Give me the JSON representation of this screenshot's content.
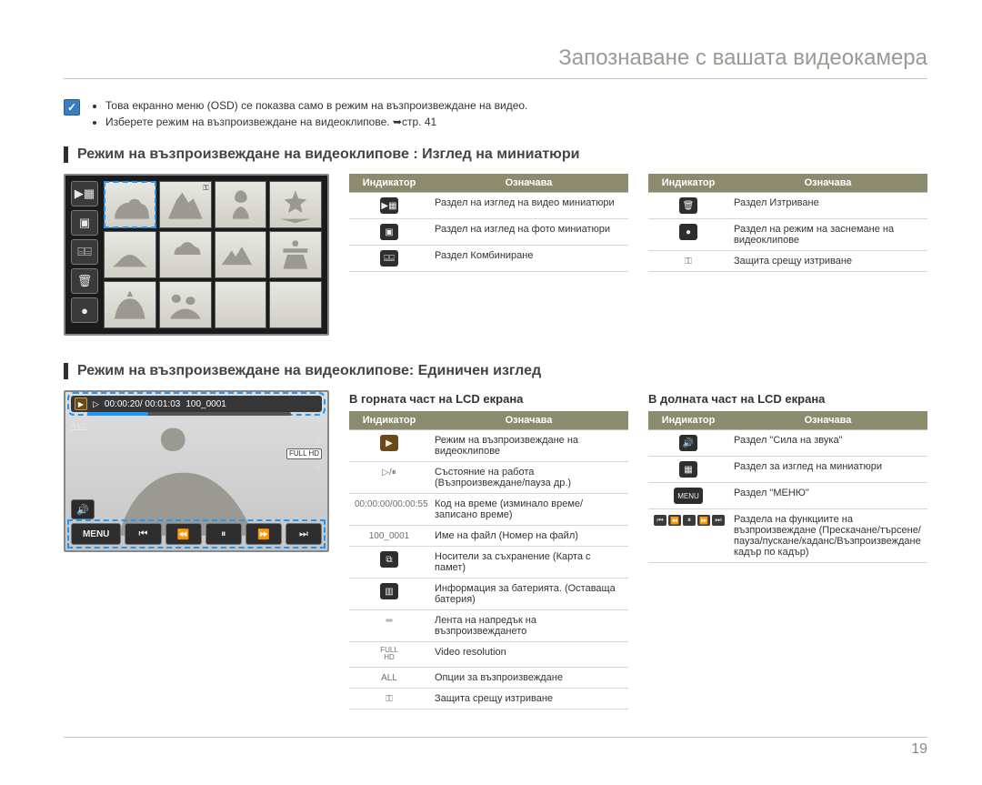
{
  "page": {
    "title": "Запознаване с вашата видеокамера",
    "number": "19"
  },
  "intro": {
    "check_glyph": "✓",
    "bullets": [
      "Това екранно меню (OSD) се показва само в режим на възпроизвеждане на видео.",
      "Изберете режим на възпроизвеждане на видеоклипове. ➥стр. 41"
    ]
  },
  "section1": {
    "title": "Режим на възпроизвеждане на видеоклипове : Изглед на миниатюри",
    "side_icons": [
      "▶▦",
      "▣",
      "⌸⌸",
      "🗑",
      "●"
    ],
    "table_headers": [
      "Индикатор",
      "Означава"
    ],
    "left_rows": [
      {
        "icon": "▶▦",
        "text": "Раздел на изглед на видео миниатюри"
      },
      {
        "icon": "▣",
        "text": "Раздел на изглед на фото миниатюри"
      },
      {
        "icon": "⌸⌸",
        "text": "Раздел Комбиниране"
      }
    ],
    "right_rows": [
      {
        "icon": "🗑",
        "text": "Раздел Изтриване"
      },
      {
        "icon": "●",
        "text": "Раздел на режим на заснемане на видеоклипове"
      },
      {
        "icon": "⚿",
        "is_text_icon": true,
        "text": "Защита срещу изтриване"
      }
    ]
  },
  "section2": {
    "title": "Режим на възпроизвеждане на видеоклипове: Единичен изглед",
    "screen": {
      "timecode": "00:00:20/ 00:01:03",
      "filecode": "100_0001",
      "all_label": "ALL",
      "full_hd": "FULL HD",
      "lock": "⚿",
      "volume_icon": "🔊",
      "menu_label": "MENU",
      "transport": [
        "⏮",
        "⏪",
        "⏸",
        "⏩",
        "⏭"
      ]
    },
    "top_table": {
      "heading": "В горната част на LCD екрана",
      "headers": [
        "Индикатор",
        "Означава"
      ],
      "rows": [
        {
          "icon": "▶",
          "variant": "play",
          "text": "Режим на възпроизвеждане на видеоклипове"
        },
        {
          "icon": "▷/⏸",
          "variant": "text",
          "text": "Състояние на работа (Възпроизвеждане/пауза др.)"
        },
        {
          "icon": "00:00:00/00:00:55",
          "variant": "text",
          "text": "Код на време (изминало време/записано време)"
        },
        {
          "icon": "100_0001",
          "variant": "text",
          "text": "Име на файл (Номер на файл)"
        },
        {
          "icon": "⧉",
          "variant": "box",
          "text": "Носители за съхранение (Карта с памет)"
        },
        {
          "icon": "▥",
          "variant": "box",
          "text": "Информация за батерията. (Оставаща батерия)"
        },
        {
          "icon": "═",
          "variant": "text",
          "text": "Лента на напредък на възпроизвеждането"
        },
        {
          "icon": "FULL HD",
          "variant": "text-sm",
          "text": "Video resolution"
        },
        {
          "icon": "ALL",
          "variant": "text",
          "text": "Опции за възпроизвеждане"
        },
        {
          "icon": "⚿",
          "variant": "text",
          "text": "Защита срещу изтриване"
        }
      ]
    },
    "bottom_table": {
      "heading": "В долната част на LCD екрана",
      "headers": [
        "Индикатор",
        "Означава"
      ],
      "rows": [
        {
          "icon": "🔊",
          "variant": "box",
          "text": "Раздел \"Сила на звука\""
        },
        {
          "icon": "▦",
          "variant": "box",
          "text": "Раздел за изглед на миниатюри"
        },
        {
          "icon": "MENU",
          "variant": "box-txt",
          "text": "Раздел \"МЕНЮ\""
        },
        {
          "icon": "transport",
          "variant": "transport",
          "text": "Раздела на функциите на възпроизвеждане (Прескачане/търсене/пауза/пускане/каданс/Възпроизвеждане кадър по кадър)"
        }
      ]
    }
  }
}
